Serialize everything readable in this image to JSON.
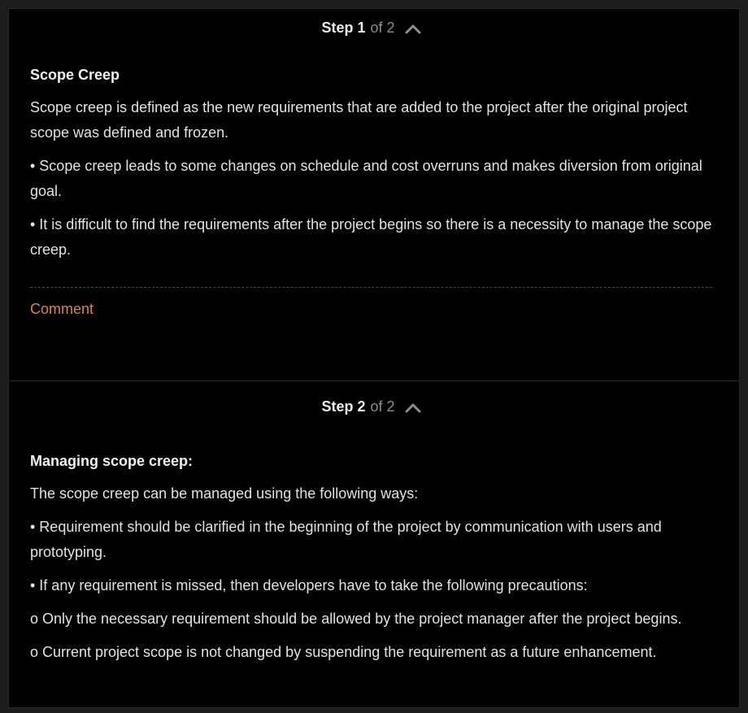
{
  "steps": [
    {
      "header": {
        "word": "Step",
        "number": "1",
        "of": "of",
        "total": "2"
      },
      "title": "Scope Creep",
      "paragraphs": [
        "Scope creep is defined as the new requirements that are added to the project after the original project scope was defined and frozen.",
        "• Scope creep leads to some changes on schedule and cost overruns and makes diversion from original goal.",
        "• It is difficult to find the requirements after the project begins so there is a necessity to manage the scope creep."
      ],
      "comment_label": "Comment"
    },
    {
      "header": {
        "word": "Step",
        "number": "2",
        "of": "of",
        "total": "2"
      },
      "title": "Managing scope creep:",
      "paragraphs": [
        "The scope creep can be managed using the following ways:",
        "• Requirement should be clarified in the beginning of the project by communication with users and prototyping.",
        "• If any requirement is missed, then developers have to take the following precautions:",
        "o Only the necessary requirement should be allowed by the project manager after the project begins.",
        "o Current project scope is not changed by suspending the requirement as a future enhancement."
      ]
    }
  ],
  "icons": {
    "collapse": "chevron-up-icon"
  },
  "colors": {
    "background": "#000000",
    "text": "#e2e2e2",
    "muted": "#8c8c8c",
    "comment": "#d2865a"
  }
}
